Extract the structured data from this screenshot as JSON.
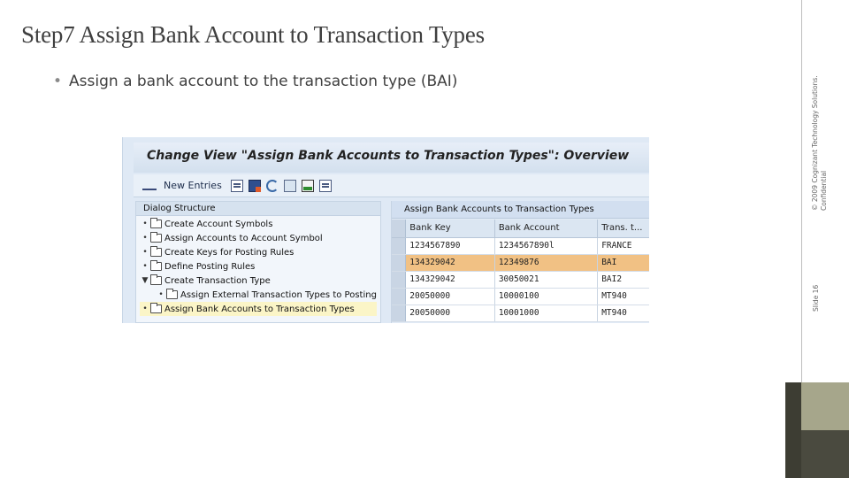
{
  "slide": {
    "title": "Step7 Assign Bank Account to Transaction Types",
    "bullet": "Assign a bank account to the transaction type (BAI)",
    "bullet_marker": "•",
    "copyright_line1": "© 2009 Cognizant Technology Solutions.",
    "copyright_line2": "Confidential",
    "slide_number": "Slide 16"
  },
  "sap": {
    "window_title": "Change View \"Assign Bank Accounts to Transaction Types\": Overview",
    "toolbar": {
      "new_entries_label": "New Entries",
      "icons": [
        "glasses-icon",
        "copy-icon",
        "save-icon",
        "undo-icon",
        "export-icon",
        "select-block-icon",
        "select-all-icon"
      ]
    },
    "dialog": {
      "header": "Dialog Structure",
      "items": [
        {
          "label": "Create Account Symbols",
          "marker": "•",
          "level": 0,
          "selected": false
        },
        {
          "label": "Assign Accounts to Account Symbol",
          "marker": "•",
          "level": 0,
          "selected": false
        },
        {
          "label": "Create Keys for Posting Rules",
          "marker": "•",
          "level": 0,
          "selected": false
        },
        {
          "label": "Define Posting Rules",
          "marker": "•",
          "level": 0,
          "selected": false
        },
        {
          "label": "Create Transaction Type",
          "marker": "▼",
          "level": 0,
          "selected": false
        },
        {
          "label": "Assign External Transaction Types to Posting",
          "marker": "•",
          "level": 1,
          "selected": false
        },
        {
          "label": "Assign Bank Accounts to Transaction Types",
          "marker": "•",
          "level": 0,
          "selected": true
        }
      ]
    },
    "grid": {
      "title": "Assign Bank Accounts to Transaction Types",
      "columns": [
        "Bank Key",
        "Bank Account",
        "Trans. t..."
      ],
      "rows": [
        {
          "bank_key": "1234567890",
          "bank_account": "1234567890l",
          "trans_type": "FRANCE",
          "highlighted": false
        },
        {
          "bank_key": "134329042",
          "bank_account": "12349876",
          "trans_type": "BAI",
          "highlighted": true
        },
        {
          "bank_key": "134329042",
          "bank_account": "30050021",
          "trans_type": "BAI2",
          "highlighted": false
        },
        {
          "bank_key": "20050000",
          "bank_account": "10000100",
          "trans_type": "MT940",
          "highlighted": false
        },
        {
          "bank_key": "20050000",
          "bank_account": "10001000",
          "trans_type": "MT940",
          "highlighted": false
        }
      ]
    }
  },
  "colors": {
    "highlight_row": "#f1c184",
    "selected_tree_item": "#fbf5c7",
    "sidebar_accent": "#a6a68b"
  }
}
